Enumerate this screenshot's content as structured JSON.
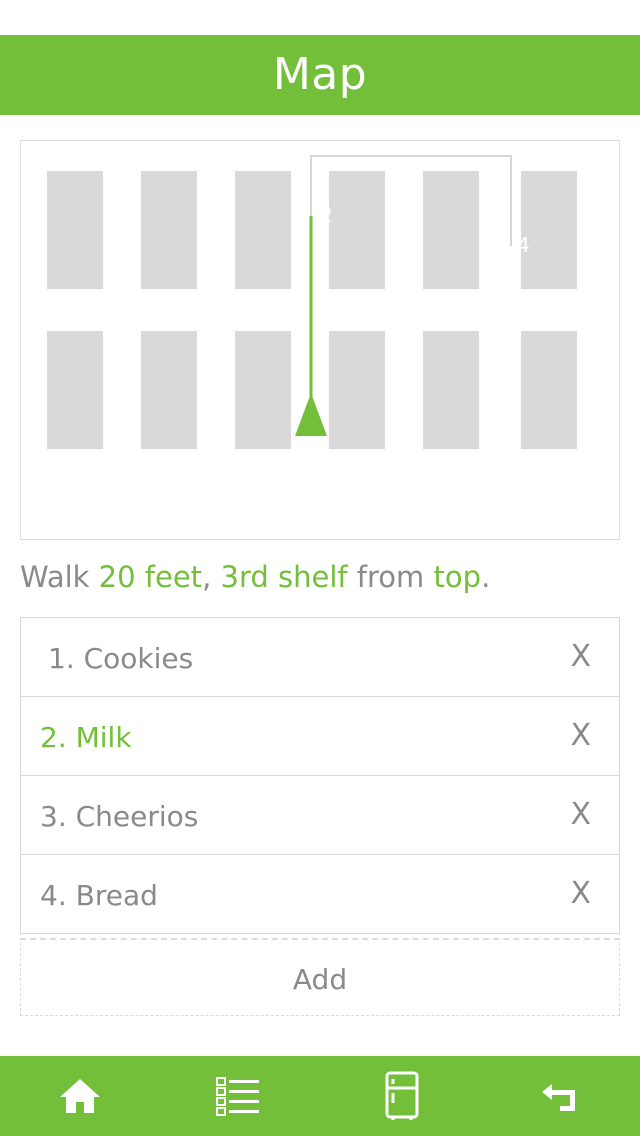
{
  "header": {
    "title": "Map"
  },
  "map": {
    "labels": [
      {
        "text": "2"
      },
      {
        "text": "4"
      }
    ]
  },
  "instruction": {
    "walk": "Walk ",
    "distance": "20 feet",
    "sep": ", ",
    "shelf": "3rd shelf",
    "from": " from ",
    "position": "top",
    "end": "."
  },
  "list": {
    "items": [
      {
        "label": "1. Cookies",
        "remove": "X"
      },
      {
        "label": "2. Milk",
        "remove": "X"
      },
      {
        "label": "3. Cheerios",
        "remove": "X"
      },
      {
        "label": "4. Bread",
        "remove": "X"
      }
    ],
    "add_label": "Add"
  },
  "tabbar": {
    "tabs": [
      "home-icon",
      "list-icon",
      "fridge-icon",
      "back-icon"
    ]
  },
  "colors": {
    "accent": "#73bf3a",
    "shelf": "#d9d9d9",
    "text": "#8a8a8a"
  }
}
